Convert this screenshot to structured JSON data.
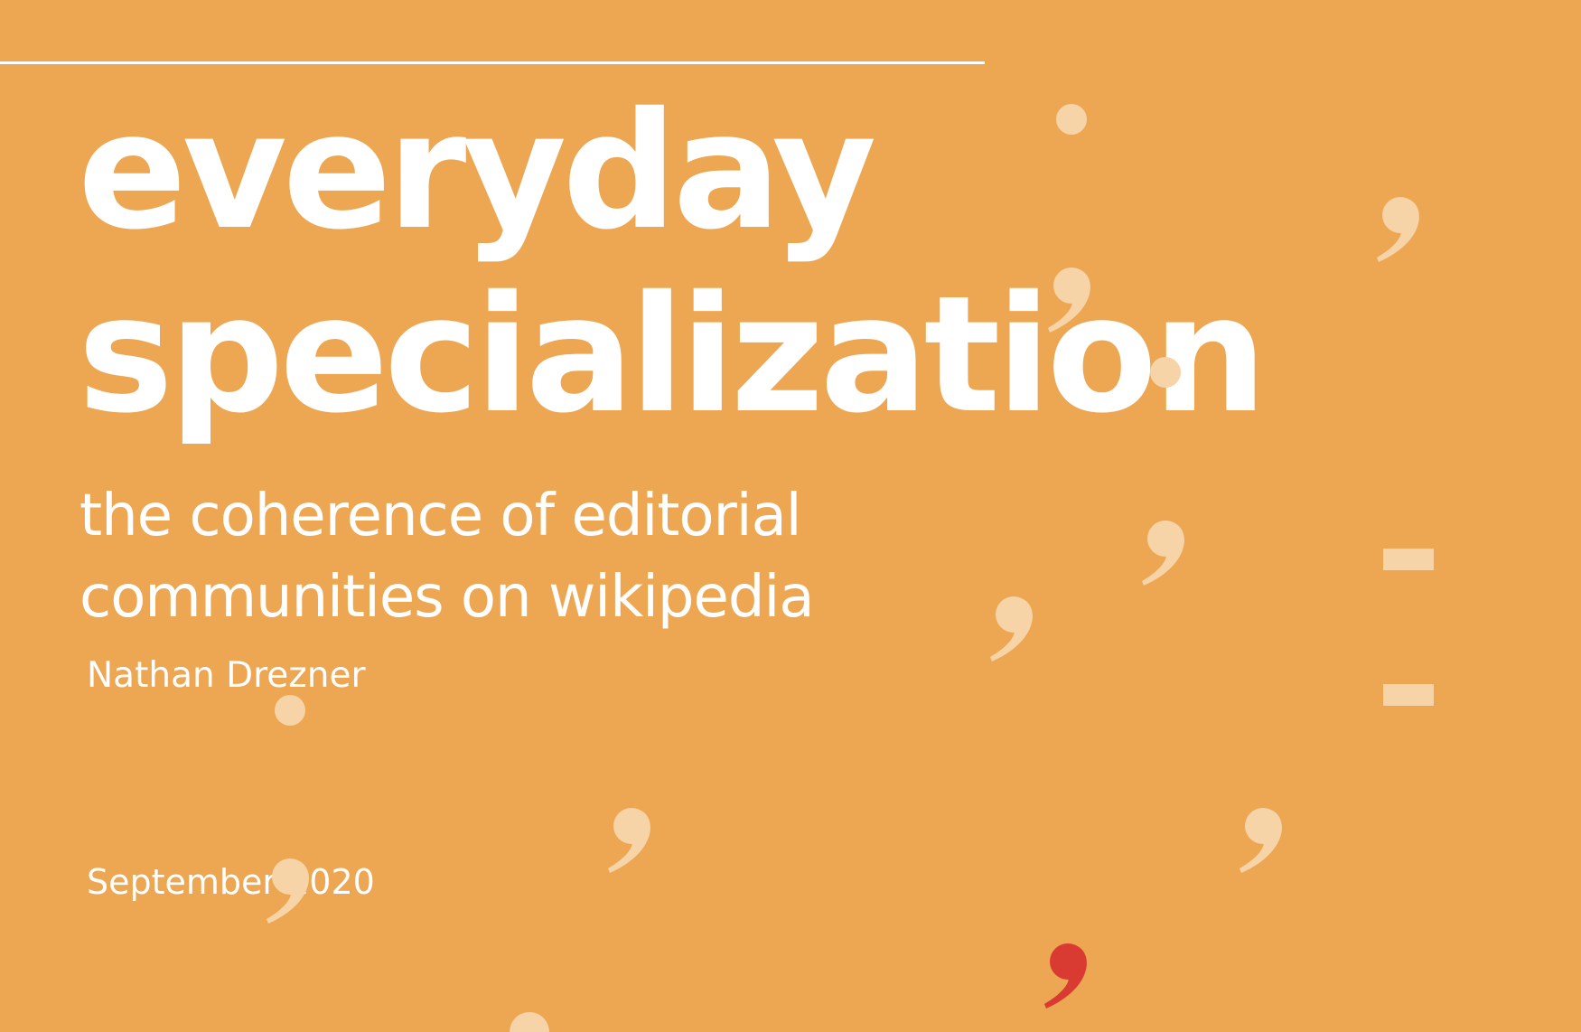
{
  "title": {
    "line1": "everyday",
    "line2": "specialization"
  },
  "subtitle": {
    "line1": "the coherence of editorial",
    "line2": "communities on wikipedia"
  },
  "author": "Nathan Drezner",
  "date": "September 2020",
  "colors": {
    "background": "#EDA753",
    "text": "#FFFFFF",
    "punctuation": "#F7D3A8",
    "accent_comma": "#D93A32"
  },
  "decorations": [
    {
      "glyph": "semicolon",
      "color": "punctuation"
    },
    {
      "glyph": "comma",
      "color": "punctuation"
    },
    {
      "glyph": "semicolon",
      "color": "punctuation"
    },
    {
      "glyph": "comma",
      "color": "punctuation"
    },
    {
      "glyph": "equals",
      "color": "punctuation"
    },
    {
      "glyph": "semicolon",
      "color": "punctuation"
    },
    {
      "glyph": "comma",
      "color": "punctuation"
    },
    {
      "glyph": "comma",
      "color": "punctuation"
    },
    {
      "glyph": "comma",
      "color": "accent_comma"
    },
    {
      "glyph": "dot",
      "color": "punctuation"
    }
  ]
}
